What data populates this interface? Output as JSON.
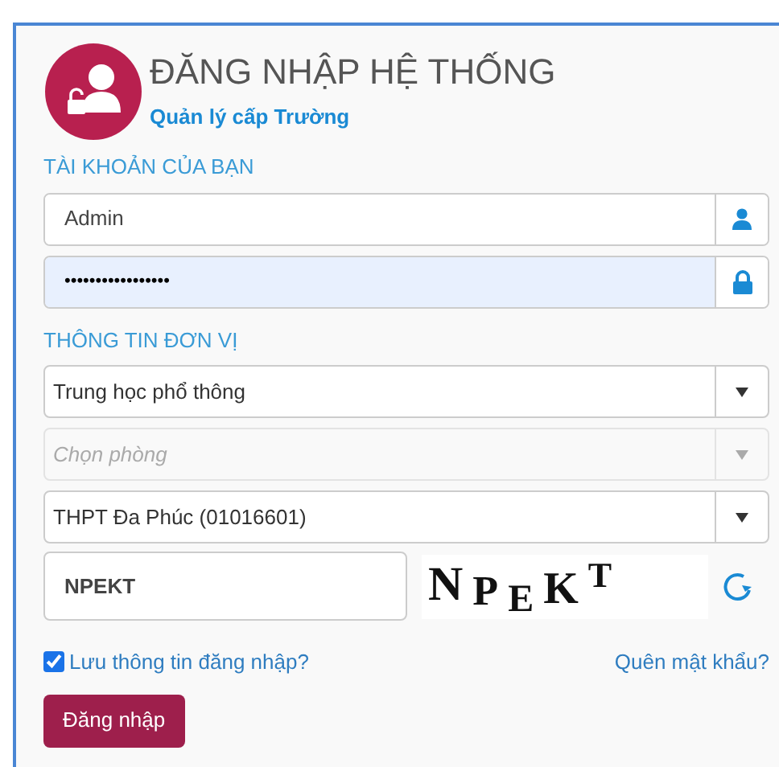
{
  "header": {
    "title": "ĐĂNG NHẬP HỆ THỐNG",
    "subtitle": "Quản lý cấp Trường"
  },
  "account": {
    "label": "TÀI KHOẢN CỦA BẠN",
    "fields": [
      {
        "kind": "text",
        "value": "Admin",
        "autofilled": false
      },
      {
        "kind": "password",
        "value": "•••••••••••••••••",
        "autofilled": true
      }
    ]
  },
  "unit": {
    "label": "THÔNG TIN ĐƠN VỊ",
    "selects": [
      {
        "value": "Trung học phổ thông",
        "disabled": false
      },
      {
        "placeholder": "Chọn phòng",
        "disabled": true
      },
      {
        "value": "THPT Đa Phúc (01016601)",
        "disabled": false
      }
    ]
  },
  "captcha": {
    "value": "NPEKT",
    "image_text": "NPEKT"
  },
  "remember": {
    "label": "Lưu thông tin đăng nhập?",
    "checked": true
  },
  "forgot_link": "Quên mật khẩu?",
  "login_button": "Đăng nhập"
}
